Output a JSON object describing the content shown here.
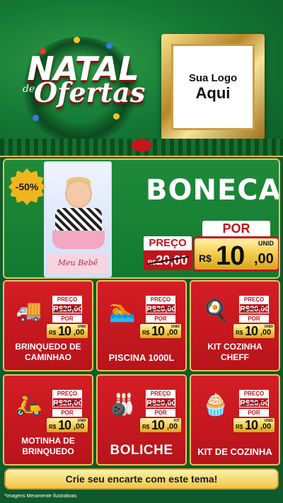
{
  "header": {
    "title_line1": "NATAL",
    "title_de": "de",
    "title_line2": "Ofertas",
    "logo_line1": "Sua Logo",
    "logo_line2": "Aqui"
  },
  "hero": {
    "discount": "-50%",
    "box_label": "Meu Bebê",
    "name": "BONECA",
    "preco_label": "PREÇO",
    "old_prefix": "R$",
    "old_price": "20,00",
    "por_label": "POR",
    "currency": "R$",
    "price_int": "10",
    "price_dec": ",00",
    "unit": "UNID"
  },
  "products": [
    {
      "name": "BRINQUEDO DE CAMINHAO",
      "icon": "🚚",
      "preco_label": "PREÇO",
      "old_price": "R$20,00",
      "por_label": "POR",
      "currency": "R$",
      "price_int": "10",
      "price_dec": ",00",
      "unit": "UNID"
    },
    {
      "name": "PISCINA 1000L",
      "icon": "🏊",
      "preco_label": "PREÇO",
      "old_price": "R$20,00",
      "por_label": "POR",
      "currency": "R$",
      "price_int": "10",
      "price_dec": ",00",
      "unit": "UNID"
    },
    {
      "name": "KIT COZINHA CHEFF",
      "icon": "🍳",
      "preco_label": "PREÇO",
      "old_price": "R$20,00",
      "por_label": "POR",
      "currency": "R$",
      "price_int": "10",
      "price_dec": ",00",
      "unit": "UNID"
    },
    {
      "name": "MOTINHA DE BRINQUEDO",
      "icon": "🛵",
      "preco_label": "PREÇO",
      "old_price": "R$20,00",
      "por_label": "POR",
      "currency": "R$",
      "price_int": "10",
      "price_dec": ",00",
      "unit": "UNID"
    },
    {
      "name": "BOLICHE",
      "icon": "🎳",
      "preco_label": "PREÇO",
      "old_price": "R$20,00",
      "por_label": "POR",
      "currency": "R$",
      "price_int": "10",
      "price_dec": ",00",
      "unit": "KIT"
    },
    {
      "name": "KIT DE COZINHA",
      "icon": "🧁",
      "preco_label": "PREÇO",
      "old_price": "R$20,00",
      "por_label": "POR",
      "currency": "R$",
      "price_int": "10",
      "price_dec": ",00",
      "unit": "UNID"
    }
  ],
  "cta": "Crie seu encarte com este tema!",
  "disclaimer": "*Imagens Meramente Ilustrativas",
  "colors": {
    "green": "#157a36",
    "red": "#c0141c",
    "gold": "#e9c25a"
  }
}
